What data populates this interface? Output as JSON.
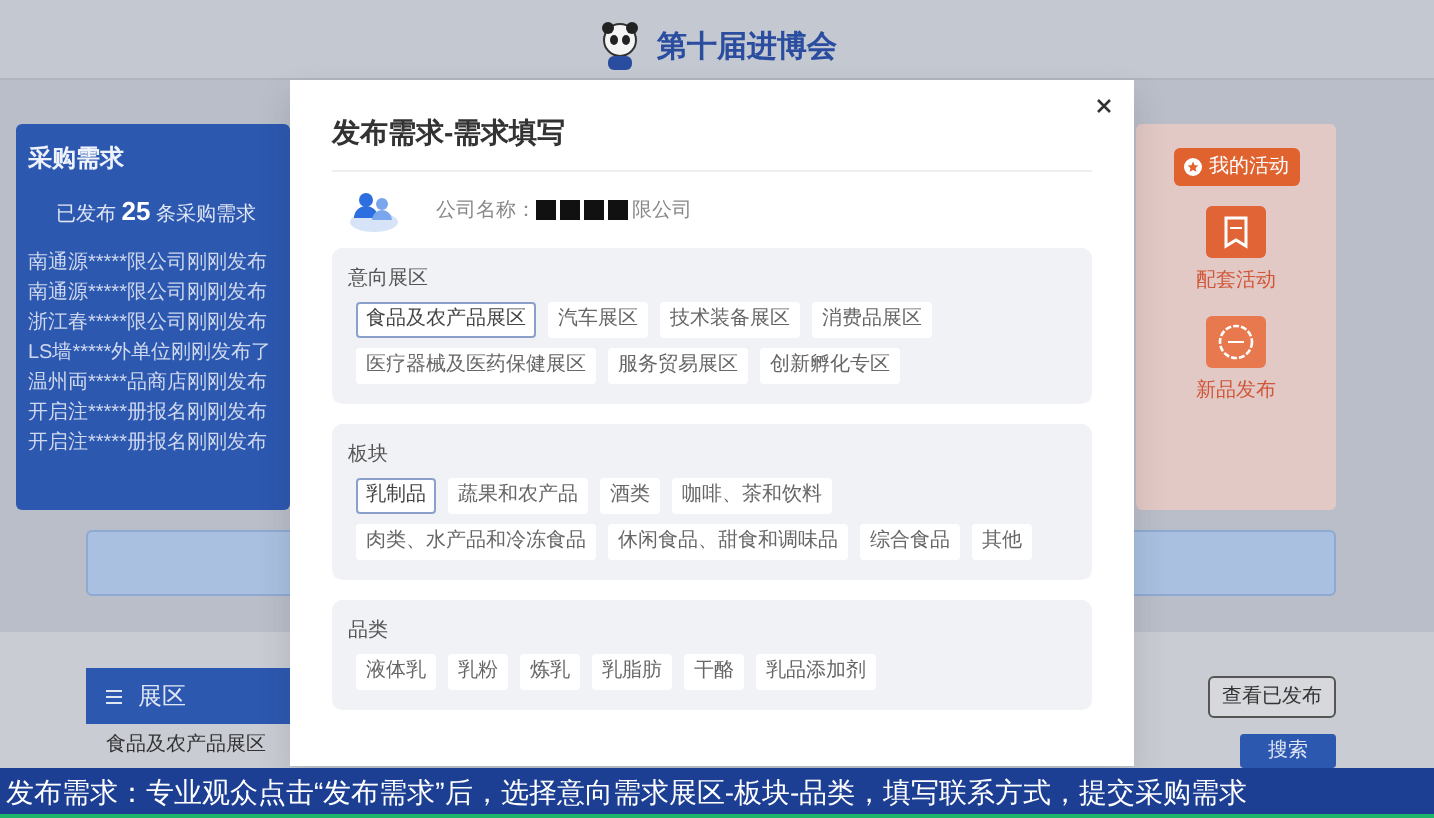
{
  "header": {
    "logo_text": "第十届进博会"
  },
  "demand_panel": {
    "title": "采购需求",
    "summary_prefix": "已发布",
    "count": "25",
    "summary_suffix": "条采购需求",
    "items": [
      "南通源*****限公司刚刚发布",
      "南通源*****限公司刚刚发布",
      "浙江春*****限公司刚刚发布",
      "LS墙*****外单位刚刚发布了",
      "温州両*****品商店刚刚发布",
      "开启注*****册报名刚刚发布",
      "开启注*****册报名刚刚发布"
    ]
  },
  "activity_panel": {
    "button": "我的活动",
    "tiles": [
      {
        "label": "配套活动",
        "kind": "bookmark"
      },
      {
        "label": "新品发布",
        "kind": "new"
      }
    ]
  },
  "zone_list": {
    "title": "展区",
    "items": [
      "食品及农产品展区"
    ]
  },
  "actions": {
    "view_published": "查看已发布",
    "search": "搜索"
  },
  "modal": {
    "title": "发布需求-需求填写",
    "company_label": "公司名称：",
    "company_name_suffix": "限公司",
    "company_name_redacted": true,
    "sections": [
      {
        "title": "意向展区",
        "tags": [
          {
            "label": "食品及农产品展区",
            "selected": true
          },
          {
            "label": "汽车展区",
            "selected": false
          },
          {
            "label": "技术装备展区",
            "selected": false
          },
          {
            "label": "消费品展区",
            "selected": false
          },
          {
            "label": "医疗器械及医药保健展区",
            "selected": false
          },
          {
            "label": "服务贸易展区",
            "selected": false
          },
          {
            "label": "创新孵化专区",
            "selected": false
          }
        ]
      },
      {
        "title": "板块",
        "tags": [
          {
            "label": "乳制品",
            "selected": true
          },
          {
            "label": "蔬果和农产品",
            "selected": false
          },
          {
            "label": "酒类",
            "selected": false
          },
          {
            "label": "咖啡、茶和饮料",
            "selected": false
          },
          {
            "label": "肉类、水产品和冷冻食品",
            "selected": false
          },
          {
            "label": "休闲食品、甜食和调味品",
            "selected": false
          },
          {
            "label": "综合食品",
            "selected": false
          },
          {
            "label": "其他",
            "selected": false
          }
        ]
      },
      {
        "title": "品类",
        "tags": [
          {
            "label": "液体乳",
            "selected": false
          },
          {
            "label": "乳粉",
            "selected": false
          },
          {
            "label": "炼乳",
            "selected": false
          },
          {
            "label": "乳脂肪",
            "selected": false
          },
          {
            "label": "干酪",
            "selected": false
          },
          {
            "label": "乳品添加剂",
            "selected": false
          }
        ]
      }
    ]
  },
  "subtitle": "发布需求：专业观众点击“发布需求”后，选择意向需求展区-板块-品类，填写联系方式，提交采购需求"
}
